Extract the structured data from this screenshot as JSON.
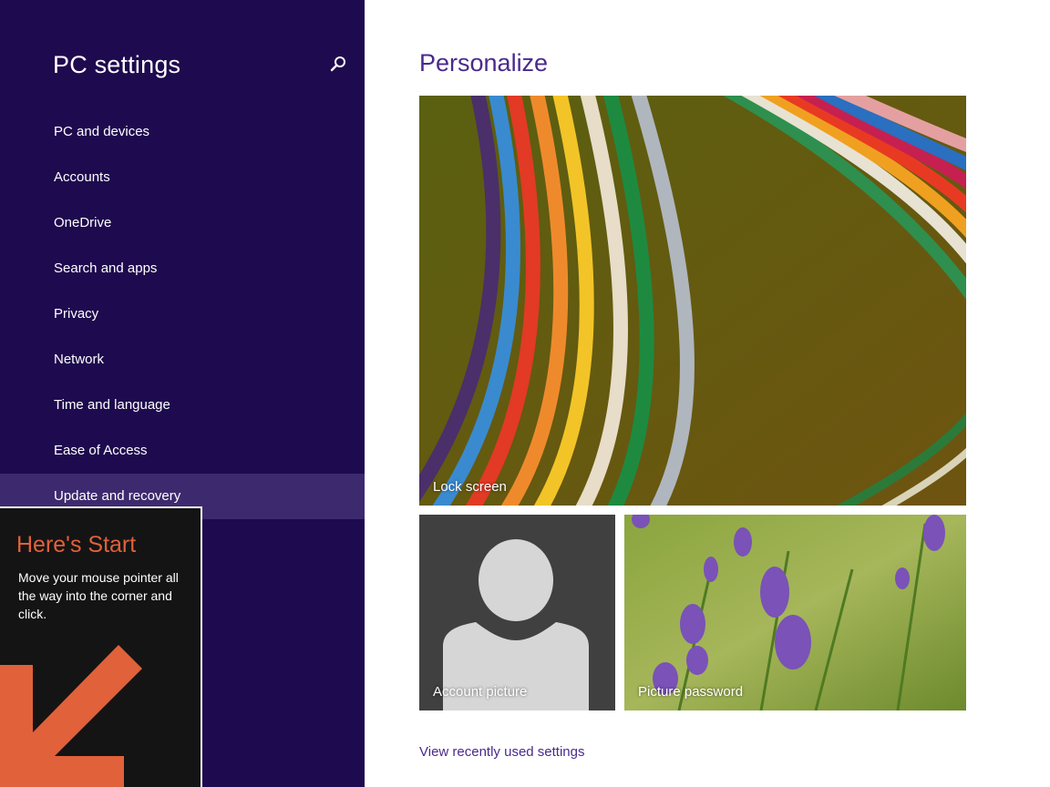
{
  "sidebar": {
    "title": "PC settings",
    "search_icon": "search-icon",
    "items": [
      {
        "label": "PC and devices"
      },
      {
        "label": "Accounts"
      },
      {
        "label": "OneDrive"
      },
      {
        "label": "Search and apps"
      },
      {
        "label": "Privacy"
      },
      {
        "label": "Network"
      },
      {
        "label": "Time and language"
      },
      {
        "label": "Ease of Access"
      },
      {
        "label": "Update and recovery",
        "selected": true
      }
    ],
    "background_color": "#1e0a4e",
    "selected_color": "#3d2a6e"
  },
  "start_hint": {
    "title": "Here's Start",
    "body": "Move your mouse pointer all the way into the corner and click.",
    "accent_color": "#e0613a",
    "icon": "arrow-down-left-icon"
  },
  "main": {
    "title": "Personalize",
    "tiles": {
      "lock_screen": {
        "label": "Lock screen"
      },
      "account_picture": {
        "label": "Account picture"
      },
      "picture_password": {
        "label": "Picture password"
      }
    },
    "recent_link": "View recently used settings",
    "accent_color": "#4a2a8c"
  }
}
